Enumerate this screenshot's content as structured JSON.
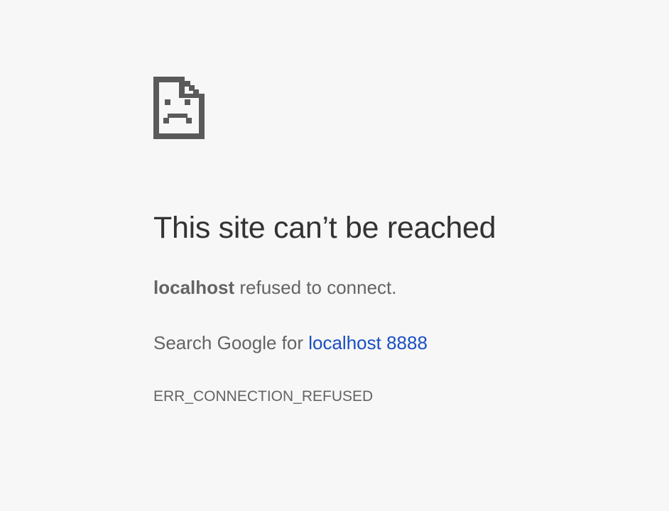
{
  "icon": "sad-page-icon",
  "colors": {
    "background": "#f7f7f7",
    "heading": "#333333",
    "body_text": "#646464",
    "link": "#1a4fc4",
    "icon": "#5a5a5a"
  },
  "error": {
    "title": "This site can’t be reached",
    "host": "localhost",
    "refused_text": " refused to connect.",
    "search_prefix": "Search Google for ",
    "search_link": "localhost 8888",
    "code": "ERR_CONNECTION_REFUSED"
  }
}
